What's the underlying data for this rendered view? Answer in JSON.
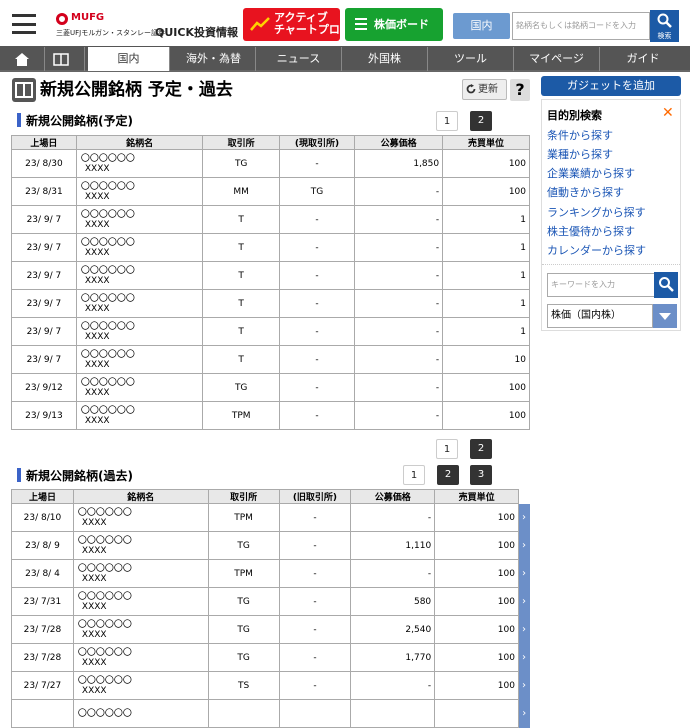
{
  "header": {
    "brand_mark": "MUFG",
    "brand_sub": "三菱UFJモルガン・スタンレー証券",
    "brand_name": "QUICK投資情報",
    "active_chart": "アクティブ\nチャートプロ",
    "stock_board": "株価ボード",
    "domestic": "国内",
    "search_placeholder": "銘柄名もしくは銘柄コードを入力",
    "search_label": "検索"
  },
  "nav": {
    "tabs": [
      "国内",
      "海外・為替",
      "ニュース",
      "外国株",
      "ツール",
      "マイページ",
      "ガイド"
    ],
    "selected": "国内"
  },
  "page": {
    "title": "新規公開銘柄 予定・過去",
    "refresh": "更新",
    "help": "?"
  },
  "scheduled": {
    "title": "新規公開銘柄(予定)",
    "pages": [
      "1",
      "2"
    ],
    "current_page": "1",
    "columns": [
      "上場日",
      "銘柄名",
      "取引所",
      "(現取引所)",
      "公募価格",
      "売買単位"
    ],
    "rows": [
      {
        "date": "23/ 8/30",
        "name1": "〇〇〇〇〇〇",
        "name2": "XXXX",
        "exchange": "TG",
        "prev": "-",
        "price": "1,850",
        "unit": "100"
      },
      {
        "date": "23/ 8/31",
        "name1": "〇〇〇〇〇〇",
        "name2": "XXXX",
        "exchange": "MM",
        "prev": "TG",
        "price": "-",
        "unit": "100"
      },
      {
        "date": "23/ 9/ 7",
        "name1": "〇〇〇〇〇〇",
        "name2": "XXXX",
        "exchange": "T",
        "prev": "-",
        "price": "-",
        "unit": "1"
      },
      {
        "date": "23/ 9/ 7",
        "name1": "〇〇〇〇〇〇",
        "name2": "XXXX",
        "exchange": "T",
        "prev": "-",
        "price": "-",
        "unit": "1"
      },
      {
        "date": "23/ 9/ 7",
        "name1": "〇〇〇〇〇〇",
        "name2": "XXXX",
        "exchange": "T",
        "prev": "-",
        "price": "-",
        "unit": "1"
      },
      {
        "date": "23/ 9/ 7",
        "name1": "〇〇〇〇〇〇",
        "name2": "XXXX",
        "exchange": "T",
        "prev": "-",
        "price": "-",
        "unit": "1"
      },
      {
        "date": "23/ 9/ 7",
        "name1": "〇〇〇〇〇〇",
        "name2": "XXXX",
        "exchange": "T",
        "prev": "-",
        "price": "-",
        "unit": "1"
      },
      {
        "date": "23/ 9/ 7",
        "name1": "〇〇〇〇〇〇",
        "name2": "XXXX",
        "exchange": "T",
        "prev": "-",
        "price": "-",
        "unit": "10"
      },
      {
        "date": "23/ 9/12",
        "name1": "〇〇〇〇〇〇",
        "name2": "XXXX",
        "exchange": "TG",
        "prev": "-",
        "price": "-",
        "unit": "100"
      },
      {
        "date": "23/ 9/13",
        "name1": "〇〇〇〇〇〇",
        "name2": "XXXX",
        "exchange": "TPM",
        "prev": "-",
        "price": "-",
        "unit": "100"
      }
    ]
  },
  "past": {
    "title": "新規公開銘柄(過去)",
    "pages": [
      "1",
      "2",
      "3"
    ],
    "current_page": "1",
    "columns": [
      "上場日",
      "銘柄名",
      "取引所",
      "(旧取引所)",
      "公募価格",
      "売買単位"
    ],
    "rows": [
      {
        "date": "23/ 8/10",
        "name1": "〇〇〇〇〇〇",
        "name2": "XXXX",
        "exchange": "TPM",
        "prev": "-",
        "price": "-",
        "unit": "100"
      },
      {
        "date": "23/ 8/ 9",
        "name1": "〇〇〇〇〇〇",
        "name2": "XXXX",
        "exchange": "TG",
        "prev": "-",
        "price": "1,110",
        "unit": "100"
      },
      {
        "date": "23/ 8/ 4",
        "name1": "〇〇〇〇〇〇",
        "name2": "XXXX",
        "exchange": "TPM",
        "prev": "-",
        "price": "-",
        "unit": "100"
      },
      {
        "date": "23/ 7/31",
        "name1": "〇〇〇〇〇〇",
        "name2": "XXXX",
        "exchange": "TG",
        "prev": "-",
        "price": "580",
        "unit": "100"
      },
      {
        "date": "23/ 7/28",
        "name1": "〇〇〇〇〇〇",
        "name2": "XXXX",
        "exchange": "TG",
        "prev": "-",
        "price": "2,540",
        "unit": "100"
      },
      {
        "date": "23/ 7/28",
        "name1": "〇〇〇〇〇〇",
        "name2": "XXXX",
        "exchange": "TG",
        "prev": "-",
        "price": "1,770",
        "unit": "100"
      },
      {
        "date": "23/ 7/27",
        "name1": "〇〇〇〇〇〇",
        "name2": "XXXX",
        "exchange": "TS",
        "prev": "-",
        "price": "-",
        "unit": "100"
      },
      {
        "date": "",
        "name1": "〇〇〇〇〇〇",
        "name2": "",
        "exchange": "",
        "prev": "",
        "price": "",
        "unit": ""
      }
    ]
  },
  "sidebar": {
    "gadget": "ガジェットを追加",
    "panel_title": "目的別検索",
    "close": "✕",
    "links": [
      "条件から探す",
      "業種から探す",
      "企業業績から探す",
      "値動きから探す",
      "ランキングから探す",
      "株主優待から探す",
      "カレンダーから探す"
    ],
    "keyword_placeholder": "キーワードを入力",
    "select_value": "株価（国内株）"
  }
}
